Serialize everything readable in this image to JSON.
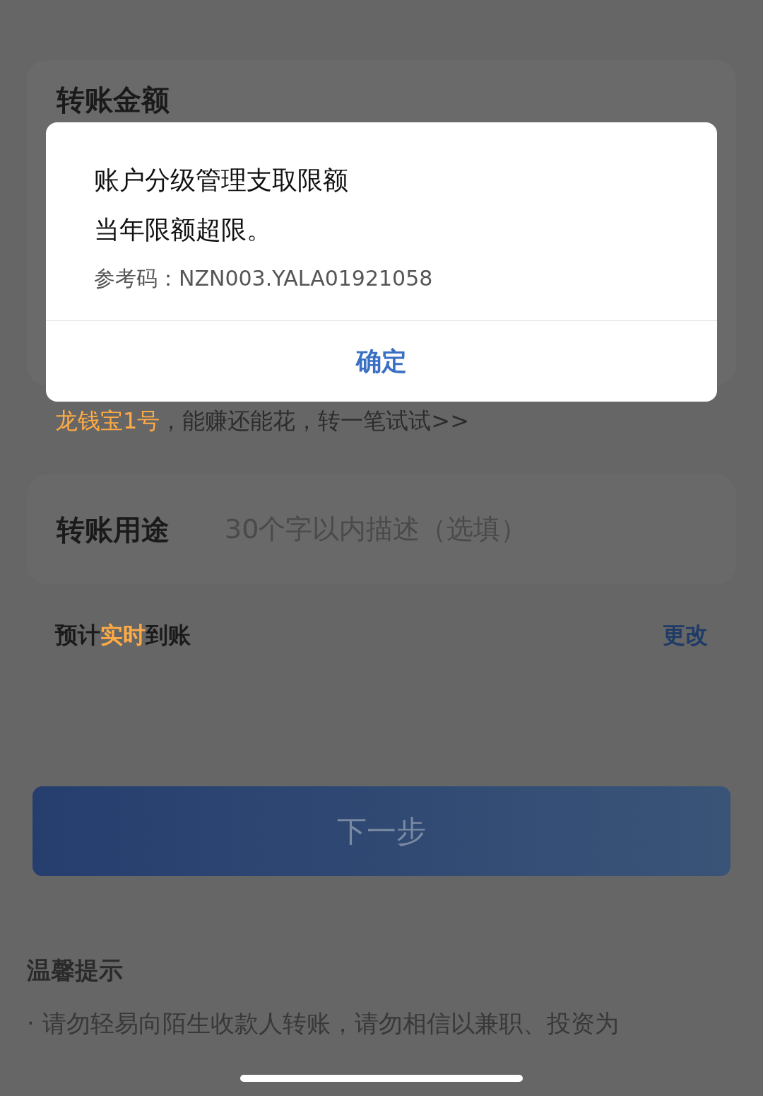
{
  "amount_card": {
    "title": "转账金额"
  },
  "promo": {
    "segments": [
      {
        "text": "龙钱宝1号",
        "highlight": true
      },
      {
        "text": "，能赚还能花，转一笔试试>>",
        "highlight": false
      }
    ]
  },
  "purpose": {
    "label": "转账用途",
    "placeholder": "30个字以内描述（选填）"
  },
  "arrival": {
    "segments": [
      {
        "text": "预计",
        "highlight": false
      },
      {
        "text": "实时",
        "highlight": true
      },
      {
        "text": "到账",
        "highlight": false
      }
    ],
    "action": "更改"
  },
  "next_button": {
    "label": "下一步",
    "disabled": true
  },
  "tips": {
    "title": "温馨提示",
    "lines": [
      "· 请勿轻易向陌生收款人转账，请勿相信以兼职、投资为"
    ]
  },
  "dialog": {
    "message": [
      "账户分级管理支取限额",
      "当年限额超限。"
    ],
    "reference": "参考码：NZN003.YALA01921058",
    "button": "确定"
  }
}
